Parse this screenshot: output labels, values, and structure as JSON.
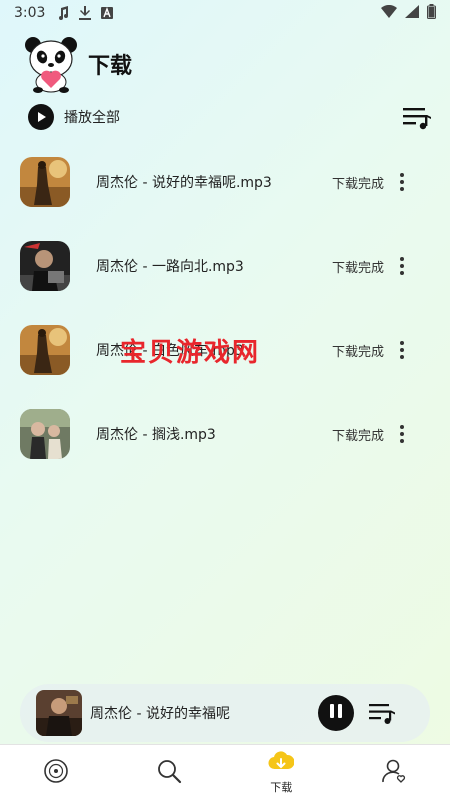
{
  "status_bar": {
    "time": "3:03",
    "icons": [
      "music-note-icon",
      "download-arrow-icon",
      "font-a-icon"
    ],
    "right_icons": [
      "wifi-icon",
      "cell-signal-icon",
      "battery-icon"
    ]
  },
  "header": {
    "logo": "panda-mascot-logo",
    "title": "下载"
  },
  "toolbar": {
    "play_all_label": "播放全部",
    "play_icon": "play-icon",
    "queue_icon": "playlist-queue-icon"
  },
  "songs": [
    {
      "title": "周杰伦 - 说好的幸福呢.mp3",
      "status": "下载完成",
      "cover": "cover-art-1"
    },
    {
      "title": "周杰伦 - 一路向北.mp3",
      "status": "下载完成",
      "cover": "cover-art-2"
    },
    {
      "title": "周杰伦 - 白色风车.mp3",
      "status": "下载完成",
      "cover": "cover-art-1"
    },
    {
      "title": "周杰伦 - 搁浅.mp3",
      "status": "下载完成",
      "cover": "cover-art-3"
    }
  ],
  "watermark": "宝贝游戏网",
  "mini_player": {
    "title": "周杰伦 - 说好的幸福呢",
    "state_icon": "pause-icon",
    "queue_icon": "playlist-queue-icon"
  },
  "bottom_nav": {
    "items": [
      {
        "icon": "disc-icon",
        "label": ""
      },
      {
        "icon": "search-icon",
        "label": ""
      },
      {
        "icon": "cloud-download-icon",
        "label": "下载",
        "active": true
      },
      {
        "icon": "user-profile-icon",
        "label": ""
      }
    ]
  },
  "colors": {
    "accent_active": "#f5c518",
    "watermark": "#e8262c",
    "button_dark": "#111111"
  }
}
